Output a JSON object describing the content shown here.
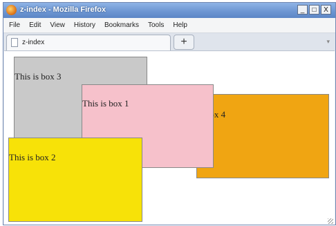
{
  "window": {
    "title": "z-index - Mozilla Firefox",
    "controls": [
      "_",
      "□",
      "X"
    ]
  },
  "menubar": {
    "items": [
      "File",
      "Edit",
      "View",
      "History",
      "Bookmarks",
      "Tools",
      "Help"
    ]
  },
  "tabs": {
    "active_label": "z-index",
    "new_tab_label": "+"
  },
  "content": {
    "boxes": {
      "box3": {
        "text": "This is box 3",
        "color": "#c9c9c9"
      },
      "box1": {
        "text": "This is box 1",
        "color": "#f6c1cb"
      },
      "box4": {
        "text": "is box 4",
        "color": "#f0a512"
      },
      "box2": {
        "text": "This is box 2",
        "color": "#f7e208"
      }
    }
  }
}
